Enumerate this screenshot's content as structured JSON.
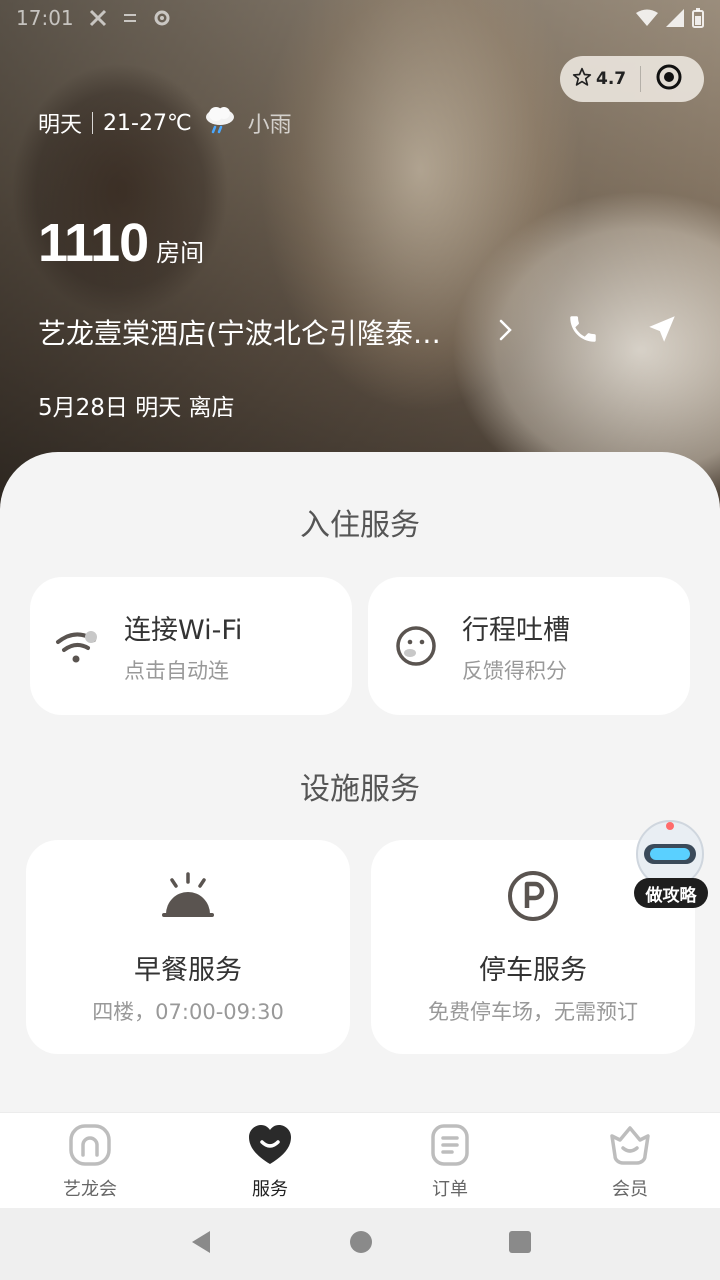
{
  "status_bar": {
    "time": "17:01"
  },
  "capsule": {
    "rating": "4.7"
  },
  "weather": {
    "day": "明天",
    "temp": "21-27℃",
    "condition": "小雨"
  },
  "room": {
    "number": "1110",
    "unit": "房间"
  },
  "hotel": {
    "name": "艺龙壹棠酒店(宁波北仑引隆泰…"
  },
  "checkout": "5月28日 明天 离店",
  "checkin_services": {
    "title": "入住服务",
    "wifi": {
      "title": "连接Wi-Fi",
      "sub": "点击自动连"
    },
    "feedback": {
      "title": "行程吐槽",
      "sub": "反馈得积分"
    }
  },
  "facility_services": {
    "title": "设施服务",
    "breakfast": {
      "title": "早餐服务",
      "sub": "四楼，07:00-09:30"
    },
    "parking": {
      "title": "停车服务",
      "sub": "免费停车场，无需预订"
    }
  },
  "mascot": {
    "label": "做攻略"
  },
  "tabs": [
    {
      "label": "艺龙会",
      "icon": "home-icon"
    },
    {
      "label": "服务",
      "icon": "heart-smile-icon"
    },
    {
      "label": "订单",
      "icon": "order-icon"
    },
    {
      "label": "会员",
      "icon": "member-icon"
    }
  ],
  "colors": {
    "accent": "#222222",
    "icon_gray": "#5a5450",
    "card_bg": "#ffffff"
  }
}
